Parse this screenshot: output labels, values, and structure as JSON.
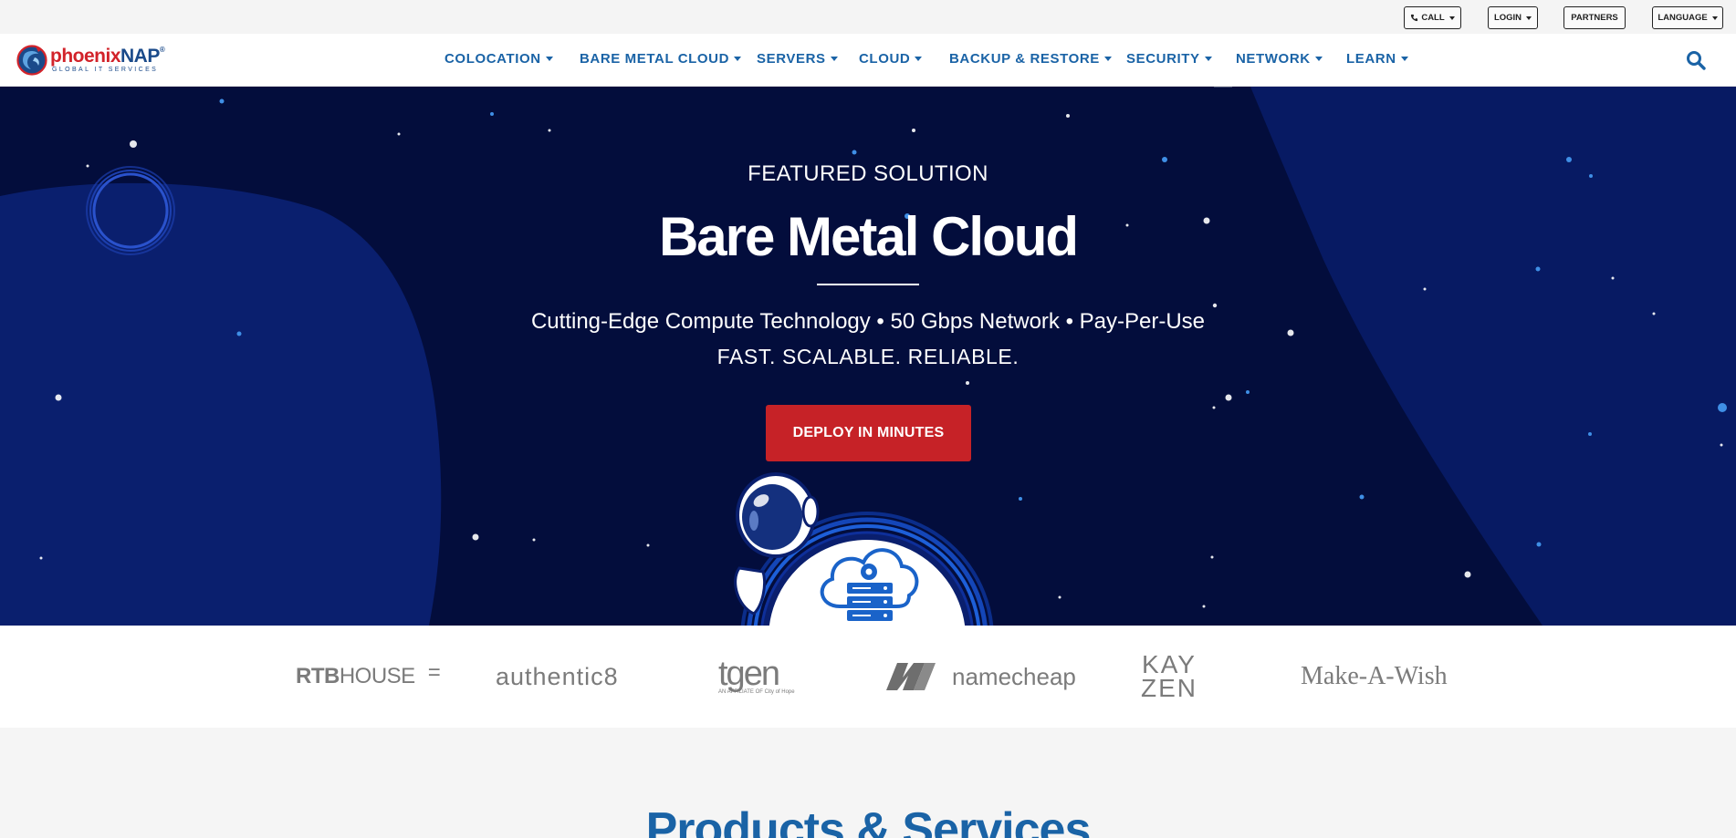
{
  "utility": {
    "call_label": "CALL",
    "login_label": "LOGIN",
    "partners_label": "PARTNERS",
    "language_label": "LANGUAGE"
  },
  "brand": {
    "name_prefix": "phoenix",
    "name_suffix": "NAP",
    "tagline": "GLOBAL IT SERVICES",
    "reg_mark": "®"
  },
  "nav": {
    "items": [
      {
        "label": "COLOCATION"
      },
      {
        "label": "BARE METAL CLOUD"
      },
      {
        "label": "SERVERS"
      },
      {
        "label": "CLOUD"
      },
      {
        "label": "BACKUP & RESTORE"
      },
      {
        "label": "SECURITY"
      },
      {
        "label": "NETWORK"
      },
      {
        "label": "LEARN"
      }
    ]
  },
  "hero": {
    "eyebrow": "FEATURED SOLUTION",
    "title": "Bare Metal Cloud",
    "subtitle": "Cutting-Edge Compute Technology • 50 Gbps Network • Pay-Per-Use",
    "tagline": "FAST. SCALABLE. RELIABLE.",
    "cta_label": "DEPLOY IN MINUTES"
  },
  "clients": {
    "rtb_a": "RTB",
    "rtb_b": "HOUSE",
    "rtb_c": "=",
    "authentic8": "authentic8",
    "tgen": "tgen",
    "tgen_note": "AN AFFILIATE OF City of Hope",
    "namecheap": "namecheap",
    "kayzen_top": "KAY",
    "kayzen_bottom": "ZEN",
    "makeawish": "Make-A-Wish"
  },
  "products": {
    "title": "Products & Services"
  },
  "colors": {
    "brand_blue": "#1a63a6",
    "hero_navy": "#030d3c",
    "cta_red": "#c62227",
    "logo_red": "#d2232a"
  },
  "icons": [
    "phone-icon",
    "search-icon",
    "cloud-server-icon",
    "astronaut-illustration"
  ]
}
